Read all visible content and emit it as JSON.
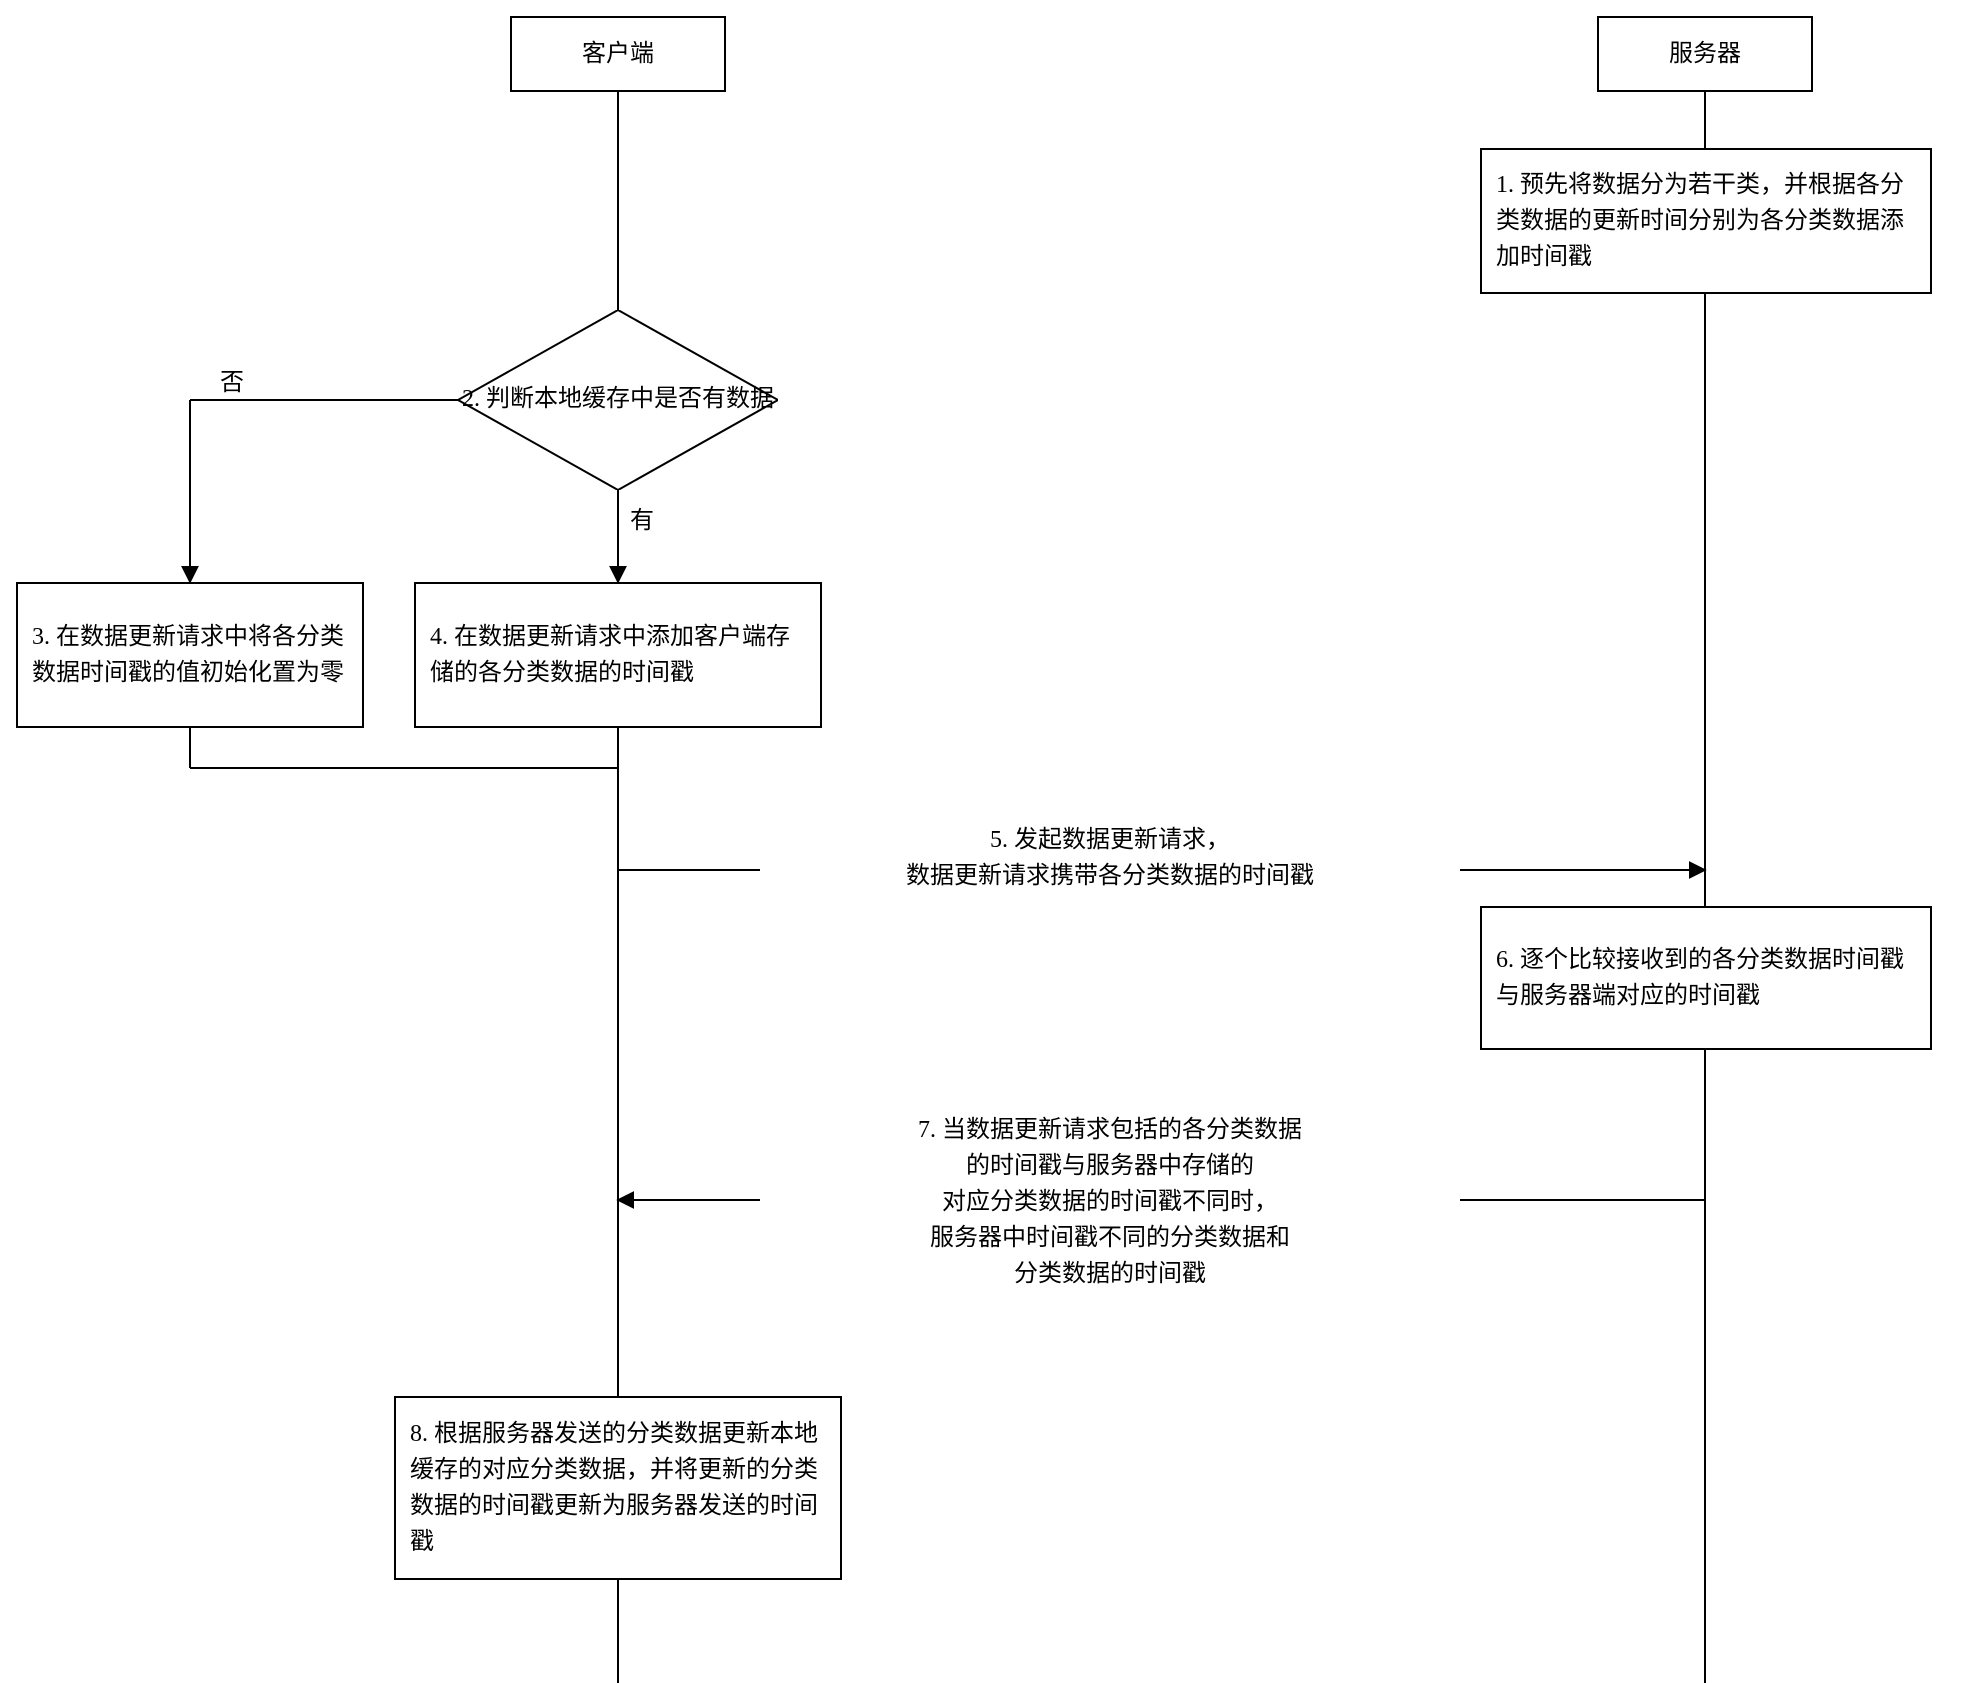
{
  "lanes": {
    "client": "客户端",
    "server": "服务器"
  },
  "nodes": {
    "step1": "1. 预先将数据分为若干类，并根据各分类数据的更新时间分别为各分类数据添加时间戳",
    "step2": "2. 判断本地缓存中是否有数据",
    "step3": "3. 在数据更新请求中将各分类数据时间戳的值初始化置为零",
    "step4": "4. 在数据更新请求中添加客户端存储的各分类数据的时间戳",
    "step6": "6. 逐个比较接收到的各分类数据时间戳与服务器端对应的时间戳",
    "step8": "8. 根据服务器发送的分类数据更新本地缓存的对应分类数据，并将更新的分类数据的时间戳更新为服务器发送的时间戳"
  },
  "branches": {
    "no": "否",
    "yes": "有"
  },
  "messages": {
    "msg5": "5. 发起数据更新请求，\n数据更新请求携带各分类数据的时间戳",
    "msg7": "7. 当数据更新请求包括的各分类数据\n的时间戳与服务器中存储的\n对应分类数据的时间戳不同时，\n服务器中时间戳不同的分类数据和\n分类数据的时间戳"
  }
}
